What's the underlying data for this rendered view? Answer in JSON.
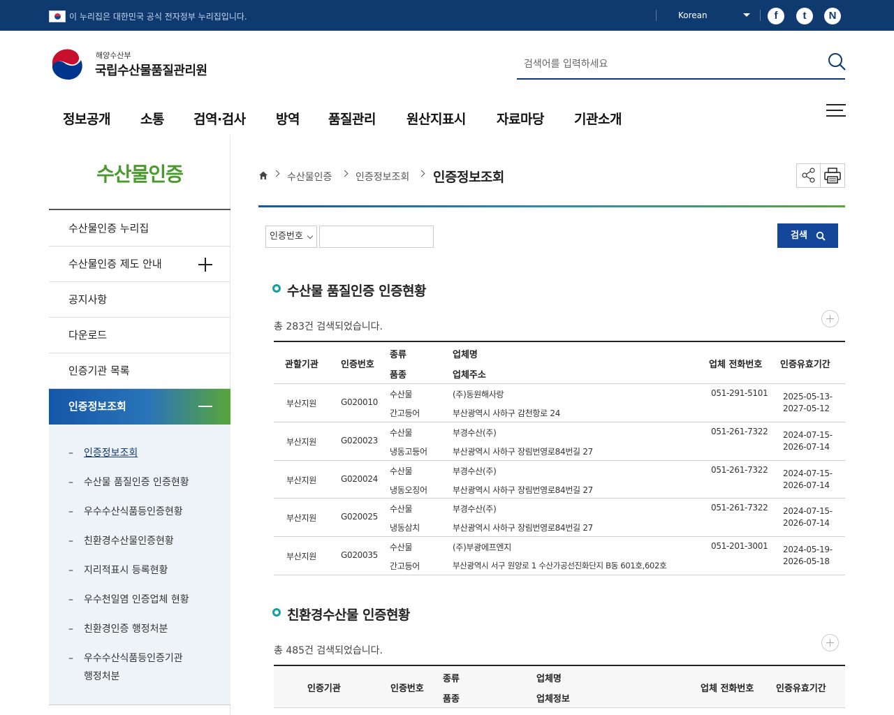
{
  "gov_bar": {
    "notice": "이 누리집은 대한민국 공식 전자정부 누리집입니다.",
    "language": "Korean",
    "sns": [
      "f",
      "t",
      "N"
    ]
  },
  "header": {
    "ministry": "해양수산부",
    "agency": "국립수산물품질관리원",
    "search_placeholder": "검색어를 입력하세요"
  },
  "gnb": [
    "정보공개",
    "소통",
    "검역·검사",
    "방역",
    "품질관리",
    "원산지표시",
    "자료마당",
    "기관소개"
  ],
  "lnb": {
    "title": "수산물인증",
    "items": [
      "수산물인증 누리집",
      "수산물인증 제도 안내",
      "공지사항",
      "다운로드",
      "인증기관 목록",
      "인증정보조회"
    ],
    "sub_items": [
      "인증정보조회",
      "수산물 품질인증 인증현황",
      "우수수산식품등인증현황",
      "친환경수산물인증현황",
      "지리적표시 등록현황",
      "우수천일염 인증업체 현황",
      "친환경인증 행정처분",
      "우수수산식품등인증기관",
      "행정처분"
    ]
  },
  "breadcrumb": {
    "items": [
      "수산물인증",
      "인증정보조회"
    ],
    "current": "인증정보조회"
  },
  "search_form": {
    "select_value": "인증번호",
    "button": "검색"
  },
  "section1": {
    "title": "수산물 품질인증 인증현황",
    "total": "총 283건 검색되었습니다.",
    "headers": {
      "agency": "관할기관",
      "cert_no": "인증번호",
      "kind": "종류",
      "variety": "품종",
      "company": "업체명",
      "address": "업체주소",
      "phone": "업체 전화번호",
      "period": "인증유효기간"
    },
    "rows": [
      {
        "agency": "부산지원",
        "cert_no": "G020010",
        "kind": "수산물",
        "variety": "간고등어",
        "company": "(주)동원해사랑",
        "address": "부산광역시 사하구 감천항로 24",
        "phone": "051-291-5101",
        "period_from": "2025-05-13-",
        "period_to": "2027-05-12"
      },
      {
        "agency": "부산지원",
        "cert_no": "G020023",
        "kind": "수산물",
        "variety": "냉동고등어",
        "company": "부경수산(주)",
        "address": "부산광역시 사하구 장림번영로84번길 27",
        "phone": "051-261-7322",
        "period_from": "2024-07-15-",
        "period_to": "2026-07-14"
      },
      {
        "agency": "부산지원",
        "cert_no": "G020024",
        "kind": "수산물",
        "variety": "냉동오징어",
        "company": "부경수산(주)",
        "address": "부산광역시 사하구 장림번영로84번길 27",
        "phone": "051-261-7322",
        "period_from": "2024-07-15-",
        "period_to": "2026-07-14"
      },
      {
        "agency": "부산지원",
        "cert_no": "G020025",
        "kind": "수산물",
        "variety": "냉동삼치",
        "company": "부경수산(주)",
        "address": "부산광역시 사하구 장림번영로84번길 27",
        "phone": "051-261-7322",
        "period_from": "2024-07-15-",
        "period_to": "2026-07-14"
      },
      {
        "agency": "부산지원",
        "cert_no": "G020035",
        "kind": "수산물",
        "variety": "간고등어",
        "company": "(주)부광에프엔지",
        "address": "부산광역시 서구 원양로 1 수산가공선진화단지 B동 601호,602호",
        "phone": "051-201-3001",
        "period_from": "2024-05-19-",
        "period_to": "2026-05-18"
      }
    ]
  },
  "section2": {
    "title": "친환경수산물 인증현황",
    "total": "총 485건 검색되었습니다.",
    "headers": {
      "agency": "인증기관",
      "cert_no": "인증번호",
      "kind": "종류",
      "variety": "품종",
      "company": "업체명",
      "info": "업체정보",
      "phone": "업체 전화번호",
      "period": "인증유효기간"
    }
  },
  "colors": {
    "navy": "#0f3a70",
    "green_title": "#4a9a2e",
    "search_button": "#14479a",
    "section_dot": "#14a0a0"
  }
}
